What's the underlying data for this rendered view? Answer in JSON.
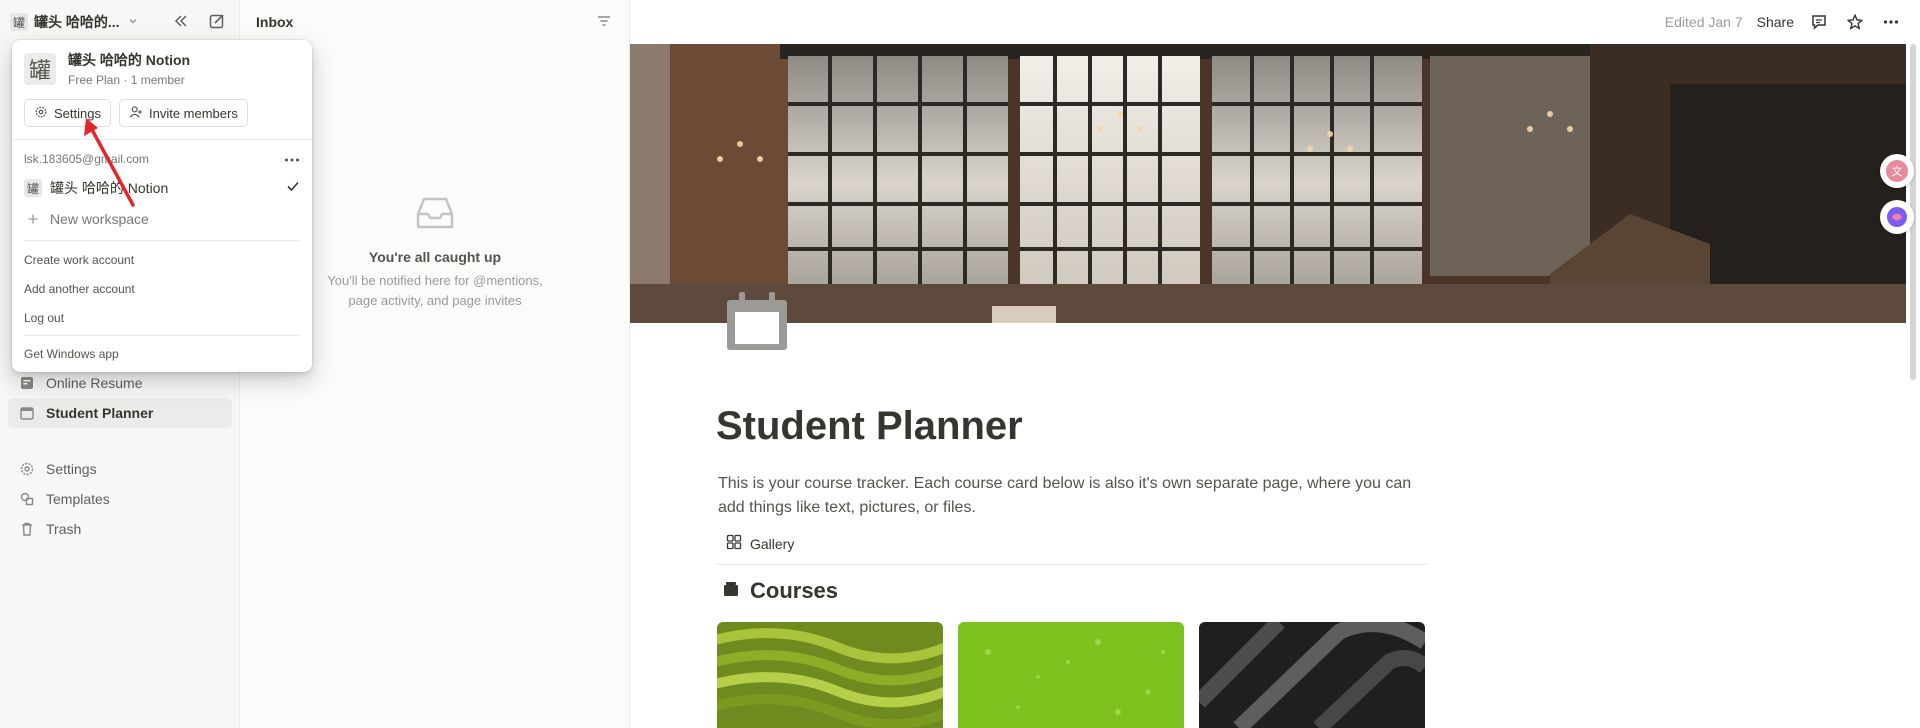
{
  "sidebar": {
    "workspace_name": "罐头 哈哈的...",
    "workspace_glyph": "罐",
    "items": [
      {
        "label": "Online Resume",
        "icon": "document-icon"
      },
      {
        "label": "Student Planner",
        "icon": "calendar-icon",
        "active": true
      }
    ],
    "bottom_items": [
      {
        "label": "Settings",
        "icon": "gear-icon"
      },
      {
        "label": "Templates",
        "icon": "templates-icon"
      },
      {
        "label": "Trash",
        "icon": "trash-icon"
      }
    ]
  },
  "inbox": {
    "title": "Inbox",
    "empty_title": "You're all caught up",
    "empty_line1": "You'll be notified here for @mentions,",
    "empty_line2": "page activity, and page invites"
  },
  "topbar": {
    "edited": "Edited Jan 7",
    "share": "Share"
  },
  "page": {
    "title": "Student Planner",
    "description": "This is your course tracker. Each course card below is also it's own separate page, where you can add things like text, pictures, or files.",
    "view_label": "Gallery",
    "section_title": "Courses"
  },
  "dropdown": {
    "workspace_name": "罐头 哈哈的 Notion",
    "workspace_glyph": "罐",
    "plan": "Free Plan · 1 member",
    "settings_label": "Settings",
    "invite_label": "Invite members",
    "email": "lsk.183605@gmail.com",
    "workspace_row": "罐头 哈哈的 Notion",
    "new_workspace": "New workspace",
    "create_work_account": "Create work account",
    "add_account": "Add another account",
    "log_out": "Log out",
    "get_app": "Get Windows app"
  },
  "colors": {
    "accent_arrow": "#e3262a",
    "sidebar_bg": "#f7f7f5"
  }
}
